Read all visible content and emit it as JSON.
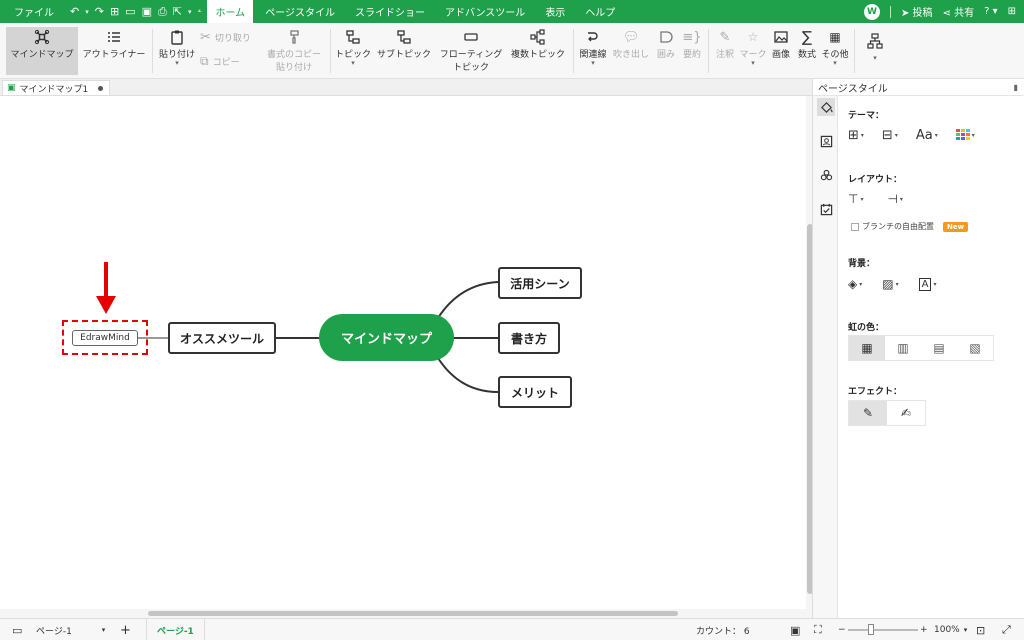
{
  "menubar": {
    "file": "ファイル",
    "tabs": [
      "ホーム",
      "ページスタイル",
      "スライドショー",
      "アドバンスツール",
      "表示",
      "ヘルプ"
    ],
    "active_tab": "ホーム",
    "avatar_letter": "W",
    "post_label": "投稿",
    "share_label": "共有"
  },
  "ribbon": {
    "mindmap": "マインドマップ",
    "outliner": "アウトライナー",
    "paste": "貼り付け",
    "cut": "切り取り",
    "copy": "コピー",
    "format_copy_1": "書式のコピー",
    "format_copy_2": "貼り付け",
    "topic": "トピック",
    "subtopic": "サブトピック",
    "floating_1": "フローティング",
    "floating_2": "トピック",
    "multi_topic": "複数トピック",
    "relation": "関連線",
    "callout": "吹き出し",
    "boundary": "囲み",
    "summary": "要約",
    "note": "注釈",
    "mark": "マーク",
    "image": "画像",
    "formula": "数式",
    "other": "その他"
  },
  "doc_tab": {
    "name": "マインドマップ1"
  },
  "canvas": {
    "central": "マインドマップ",
    "left_topic": "オススメツール",
    "floating": "EdrawMind",
    "right_topics": [
      "活用シーン",
      "書き方",
      "メリット"
    ]
  },
  "panel": {
    "title": "ページスタイル",
    "theme": "テーマ：",
    "theme_font": "Aa",
    "layout": "レイアウト：",
    "free_branch": "ブランチの自由配置",
    "new_badge": "New",
    "background": "背景：",
    "rainbow": "虹の色：",
    "effect": "エフェクト："
  },
  "statusbar": {
    "page_select": "ページ-1",
    "page_tab": "ページ-1",
    "count": "カウント： 6",
    "zoom": "100%"
  },
  "colors": {
    "brand_green": "#1ea14a",
    "annotation_red": "#e60000"
  }
}
